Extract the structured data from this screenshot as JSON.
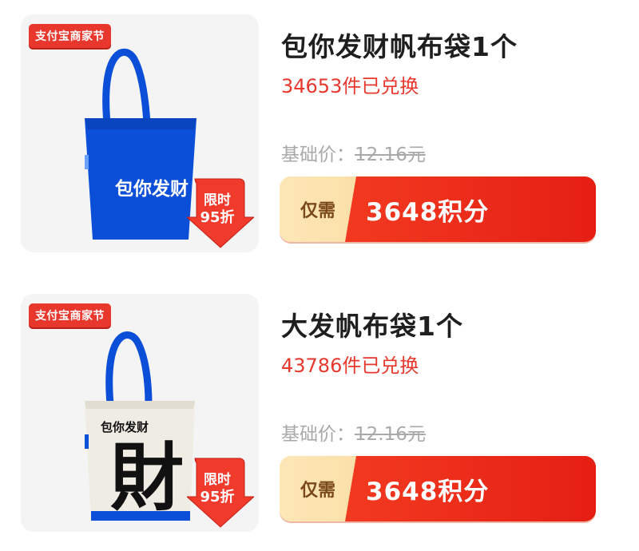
{
  "colors": {
    "accent": "#e8382d",
    "button_red": "#e51e14",
    "button_gold": "#f7c978",
    "bag_blue": "#0b4fd9"
  },
  "products": [
    {
      "tag": "支付宝商家节",
      "badge_line1": "限时",
      "badge_line2": "95折",
      "title": "包你发财帆布袋1个",
      "exchanged": "34653件已兑换",
      "base_label": "基础价：",
      "base_price": "12.16元",
      "button_prefix": "仅需",
      "button_price": "3648积分",
      "bag_text": "包你发财",
      "bag_style": "blue"
    },
    {
      "tag": "支付宝商家节",
      "badge_line1": "限时",
      "badge_line2": "95折",
      "title": "大发帆布袋1个",
      "exchanged": "43786件已兑换",
      "base_label": "基础价：",
      "base_price": "12.16元",
      "button_prefix": "仅需",
      "button_price": "3648积分",
      "bag_text": "包你发财",
      "bag_big_char": "財",
      "bag_style": "white"
    }
  ]
}
